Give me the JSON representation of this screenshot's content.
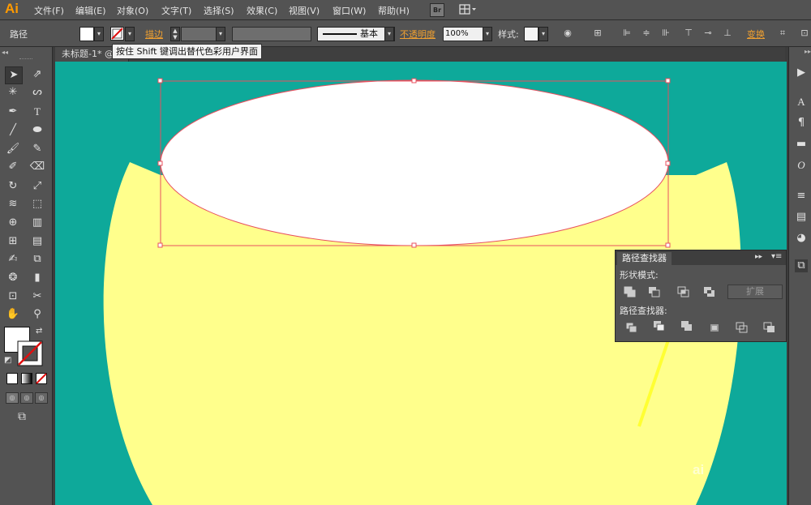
{
  "app": {
    "logo": "Ai"
  },
  "menu": {
    "items": [
      "文件(F)",
      "编辑(E)",
      "对象(O)",
      "文字(T)",
      "选择(S)",
      "效果(C)",
      "视图(V)",
      "窗口(W)",
      "帮助(H)"
    ],
    "bridge": "Br"
  },
  "control_bar": {
    "selection_label": "路径",
    "stroke_label": "描边",
    "stroke_profile": "基本",
    "opacity_label": "不透明度",
    "opacity_value": "100%",
    "style_label": "样式:",
    "transform_label": "变换"
  },
  "tooltip": {
    "text": "按住 Shift 键调出替代色彩用户界面"
  },
  "document": {
    "tab_title": "未标题-1* @"
  },
  "pathfinder": {
    "title": "路径查找器",
    "shape_modes_label": "形状模式:",
    "expand_label": "扩展",
    "pathfinders_label": "路径查找器:"
  },
  "colors": {
    "canvas_bg": "#0ea99a",
    "shape_yellow": "#ffff8c",
    "ellipse_fill": "#ffffff",
    "selection": "#e8505f",
    "arrow": "#ffff33",
    "ui_dark": "#535353"
  },
  "watermark": "ai"
}
